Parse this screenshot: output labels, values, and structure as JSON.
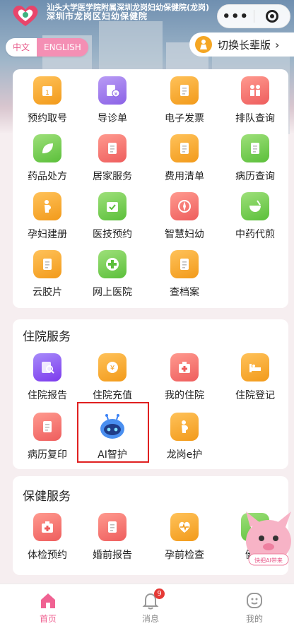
{
  "header": {
    "hospital_name_line1": "汕头大学医学院附属深圳龙岗妇幼保健院(龙岗)",
    "hospital_name_line2": "深圳市龙岗区妇幼保健院",
    "lang_zh": "中文",
    "lang_en": "ENGLISH",
    "switch_label": "切换长辈版"
  },
  "main_services": [
    {
      "label": "预约取号",
      "icon": "calendar-icon",
      "color": "#f29a1a"
    },
    {
      "label": "导诊单",
      "icon": "bill-icon",
      "color": "#8b62e6"
    },
    {
      "label": "电子发票",
      "icon": "invoice-icon",
      "color": "#f29a1a"
    },
    {
      "label": "排队查询",
      "icon": "queue-icon",
      "color": "#ee5d5d"
    },
    {
      "label": "药品处方",
      "icon": "leaf-icon",
      "color": "#5bbf3a"
    },
    {
      "label": "居家服务",
      "icon": "home-service-icon",
      "color": "#ee5d5d"
    },
    {
      "label": "费用清单",
      "icon": "list-icon",
      "color": "#f29a1a"
    },
    {
      "label": "病历查询",
      "icon": "record-icon",
      "color": "#5bbf3a"
    },
    {
      "label": "孕妇建册",
      "icon": "pregnant-icon",
      "color": "#f29a1a"
    },
    {
      "label": "医技预约",
      "icon": "check-calendar-icon",
      "color": "#5bbf3a"
    },
    {
      "label": "智慧妇幼",
      "icon": "compass-icon",
      "color": "#ee5d5d"
    },
    {
      "label": "中药代煎",
      "icon": "bowl-icon",
      "color": "#5bbf3a"
    },
    {
      "label": "云胶片",
      "icon": "film-icon",
      "color": "#f29a1a"
    },
    {
      "label": "网上医院",
      "icon": "cross-icon",
      "color": "#5bbf3a"
    },
    {
      "label": "查档案",
      "icon": "archive-icon",
      "color": "#f29a1a"
    }
  ],
  "inpatient": {
    "title": "住院服务",
    "items": [
      {
        "label": "住院报告",
        "icon": "report-search-icon",
        "color": "#7c3aed"
      },
      {
        "label": "住院充值",
        "icon": "yen-icon",
        "color": "#f29a1a"
      },
      {
        "label": "我的住院",
        "icon": "medkit-icon",
        "color": "#ee5d5d"
      },
      {
        "label": "住院登记",
        "icon": "bed-icon",
        "color": "#f29a1a"
      },
      {
        "label": "病历复印",
        "icon": "copy-icon",
        "color": "#ee5d5d"
      },
      {
        "label": "AI智护",
        "icon": "robot-icon",
        "color": "#3b82f6"
      },
      {
        "label": "龙岗e护",
        "icon": "nurse-icon",
        "color": "#f29a1a"
      }
    ]
  },
  "health": {
    "title": "保健服务",
    "items": [
      {
        "label": "体检预约",
        "icon": "medkit-icon",
        "color": "#ee5d5d"
      },
      {
        "label": "婚前报告",
        "icon": "marriage-report-icon",
        "color": "#ee5d5d"
      },
      {
        "label": "孕前检查",
        "icon": "heartbeat-icon",
        "color": "#f29a1a"
      },
      {
        "label": "健康",
        "icon": "health-icon",
        "color": "#5bbf3a"
      }
    ]
  },
  "mascot_text": "快把AI带来",
  "nav": {
    "home": "首页",
    "messages": "消息",
    "messages_badge": "9",
    "mine": "我的"
  }
}
